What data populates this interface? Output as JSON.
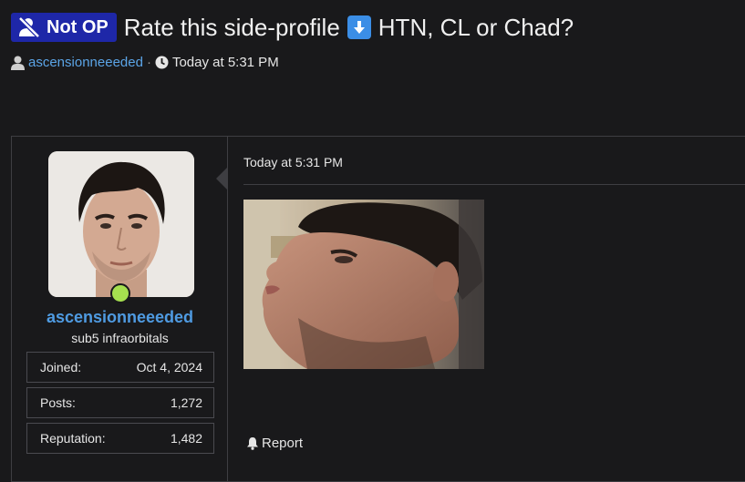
{
  "thread": {
    "prefix": "Not OP",
    "title": "Rate this side-profile",
    "title_suffix": "HTN, CL or Chad?",
    "author": "ascensionneeeded",
    "separator": "·",
    "date": "Today at 5:31 PM"
  },
  "post": {
    "date": "Today at 5:31 PM",
    "report_label": "Report",
    "user": {
      "username": "ascensionneeeded",
      "user_title": "sub5 infraorbitals",
      "online": true,
      "stats": [
        {
          "label": "Joined:",
          "value": "Oct 4, 2024"
        },
        {
          "label": "Posts:",
          "value": "1,272"
        },
        {
          "label": "Reputation:",
          "value": "1,482"
        }
      ]
    }
  },
  "colors": {
    "background": "#19191b",
    "prefix_badge": "#1e27a8",
    "link": "#5ba4e6",
    "username": "#4f9be2",
    "online": "#a6e04f",
    "border": "#3e3e42"
  },
  "icons": {
    "prefix": "no-user-icon",
    "title_emoji": "arrow-down-emoji",
    "author": "user-icon",
    "date": "clock-icon",
    "report": "bell-icon"
  }
}
